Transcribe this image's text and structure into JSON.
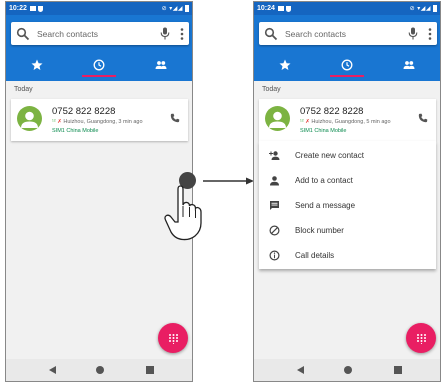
{
  "left_phone": {
    "status": {
      "time": "10:22"
    },
    "search": {
      "placeholder": "Search contacts"
    },
    "section": "Today",
    "call": {
      "number": "0752 822 8228",
      "sim_tag": "¹²",
      "details": "Huizhou, Guangdong, 3 min ago",
      "sim": "SIM1 China Mobile"
    }
  },
  "right_phone": {
    "status": {
      "time": "10:24"
    },
    "search": {
      "placeholder": "Search contacts"
    },
    "section": "Today",
    "call": {
      "number": "0752 822 8228",
      "sim_tag": "¹²",
      "details": "Huizhou, Guangdong, 5 min ago",
      "sim": "SIM1 China Mobile"
    },
    "menu": [
      {
        "label": "Create new contact",
        "icon": "person-add-icon"
      },
      {
        "label": "Add to a contact",
        "icon": "person-icon"
      },
      {
        "label": "Send a message",
        "icon": "message-icon"
      },
      {
        "label": "Block number",
        "icon": "block-icon"
      },
      {
        "label": "Call details",
        "icon": "info-icon"
      }
    ]
  },
  "colors": {
    "header_blue": "#1976d2",
    "status_blue": "#1565c0",
    "accent_pink": "#e91e63",
    "avatar_green": "#7cb342",
    "sim_green": "#0a8a4e"
  }
}
